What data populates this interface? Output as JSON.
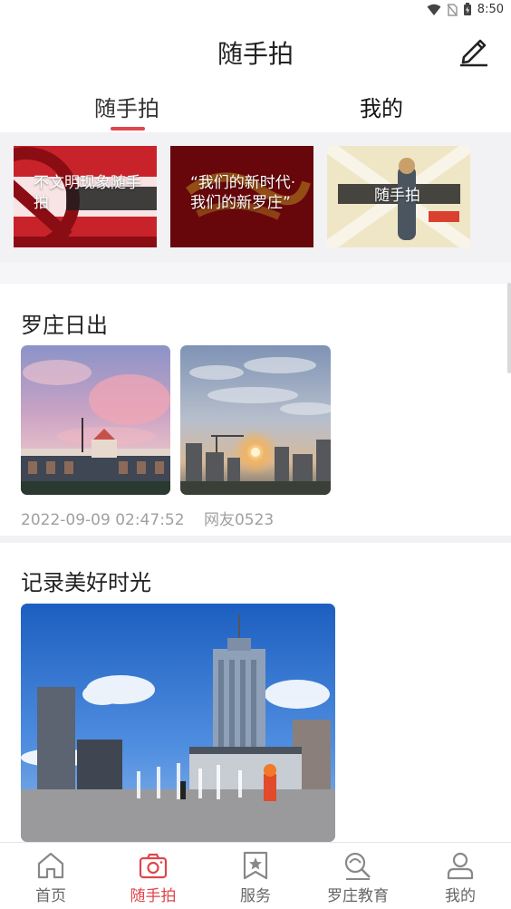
{
  "status": {
    "time": "8:50"
  },
  "header": {
    "title": "随手拍"
  },
  "tabs": [
    {
      "label": "随手拍",
      "active": true
    },
    {
      "label": "我的",
      "active": false
    }
  ],
  "banners": [
    {
      "caption": "不文明现象随手拍"
    },
    {
      "caption": "“我们的新时代·我们的新罗庄”"
    },
    {
      "caption": "随手拍"
    }
  ],
  "posts": [
    {
      "title": "罗庄日出",
      "timestamp": "2022-09-09 02:47:52",
      "author": "网友0523"
    },
    {
      "title": "记录美好时光"
    }
  ],
  "bottom_nav": [
    {
      "label": "首页",
      "icon": "home-icon",
      "active": false
    },
    {
      "label": "随手拍",
      "icon": "camera-icon",
      "active": true
    },
    {
      "label": "服务",
      "icon": "star-bookmark-icon",
      "active": false
    },
    {
      "label": "罗庄教育",
      "icon": "education-icon",
      "active": false
    },
    {
      "label": "我的",
      "icon": "user-icon",
      "active": false
    }
  ],
  "colors": {
    "accent": "#e0454b",
    "muted": "#a0a0a0",
    "background_strip": "#f2f2f5"
  }
}
